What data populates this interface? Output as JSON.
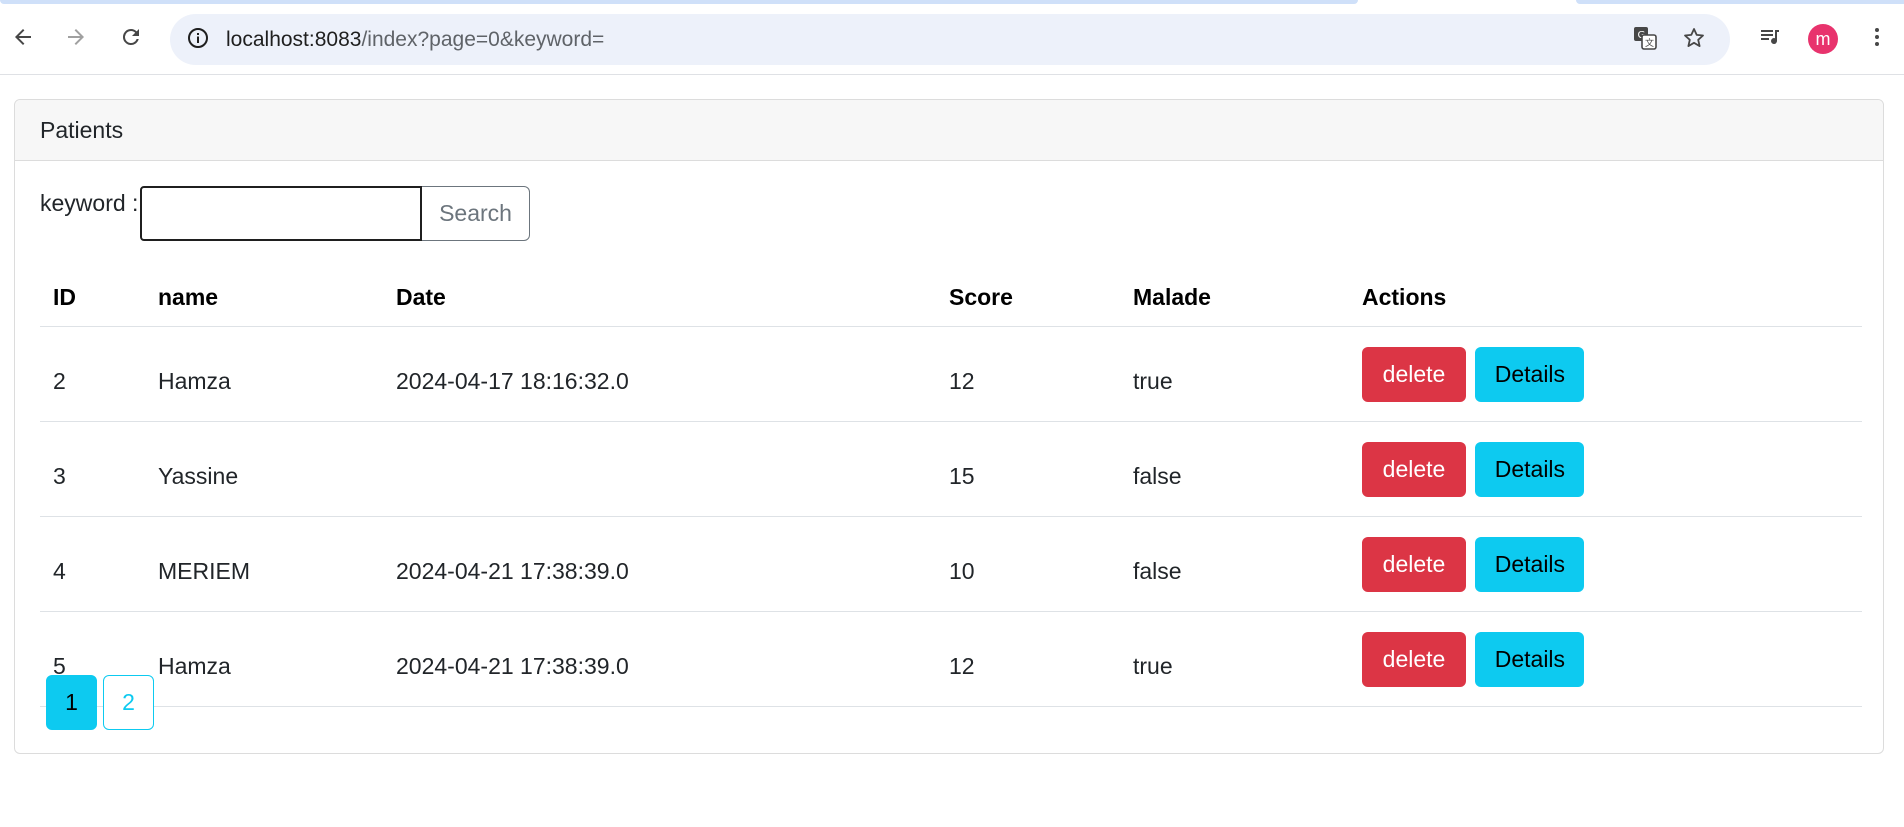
{
  "browser": {
    "url_host": "localhost:8083",
    "url_path": "/index?page=0&keyword=",
    "profile_initial": "m",
    "icons": {
      "back": "arrow-left-icon",
      "forward": "arrow-right-icon",
      "reload": "reload-icon",
      "site_info": "info-icon",
      "translate": "translate-icon",
      "bookmark": "star-icon",
      "media": "media-queue-icon",
      "menu": "kebab-menu-icon"
    }
  },
  "card": {
    "title": "Patients"
  },
  "search": {
    "label": "keyword :",
    "value": "",
    "button_label": "Search"
  },
  "table": {
    "headers": {
      "id": "ID",
      "name": "name",
      "date": "Date",
      "score": "Score",
      "malade": "Malade",
      "actions": "Actions"
    },
    "rows": [
      {
        "id": "2",
        "name": "Hamza",
        "date": "2024-04-17 18:16:32.0",
        "score": "12",
        "malade": "true",
        "delete_label": "delete",
        "details_label": "Details"
      },
      {
        "id": "3",
        "name": "Yassine",
        "date": "",
        "score": "15",
        "malade": "false",
        "delete_label": "delete",
        "details_label": "Details"
      },
      {
        "id": "4",
        "name": "MERIEM",
        "date": "2024-04-21 17:38:39.0",
        "score": "10",
        "malade": "false",
        "delete_label": "delete",
        "details_label": "Details"
      },
      {
        "id": "5",
        "name": "Hamza",
        "date": "2024-04-21 17:38:39.0",
        "score": "12",
        "malade": "true",
        "delete_label": "delete",
        "details_label": "Details"
      }
    ]
  },
  "pagination": {
    "pages": [
      "1",
      "2"
    ],
    "active": "1"
  },
  "colors": {
    "danger": "#dc3545",
    "info": "#0dcaf0",
    "avatar": "#e8336d",
    "omnibox": "#edf1fa"
  }
}
